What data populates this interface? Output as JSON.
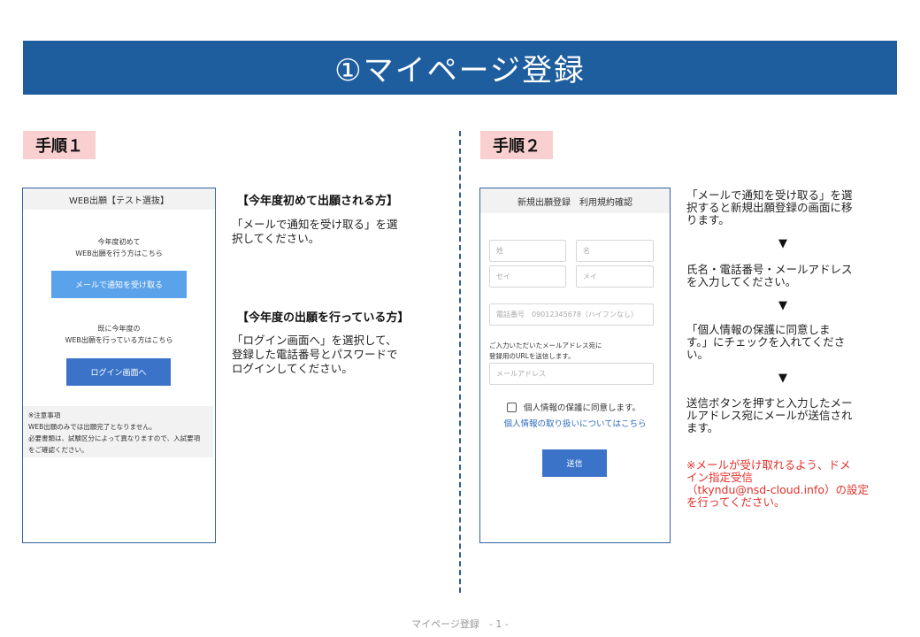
{
  "title": "①マイページ登録",
  "step1": {
    "badge": "手順１",
    "phone": {
      "header": "WEB出願【テスト選抜】",
      "first_time_line1": "今年度初めて",
      "first_time_line2": "WEB出願を行う方はこちら",
      "mail_button": "メールで通知を受け取る",
      "existing_line1": "既に今年度の",
      "existing_line2": "WEB出願を行っている方はこちら",
      "login_button": "ログイン画面へ",
      "notes": [
        "※注意事項",
        "WEB出願のみでは出願完了となりません。",
        "必要書類は、試験区分によって異なりますので、入試要項",
        "をご確認ください。"
      ]
    },
    "heading1": "【今年度初めて出願される方】",
    "text1": [
      "「メールで通知を受け取る」を選",
      "択してください。"
    ],
    "heading2": "【今年度の出願を行っている方】",
    "text2": [
      "「ログイン画面へ」を選択して、",
      "登録した電話番号とパスワードで",
      "ログインしてください。"
    ]
  },
  "step2": {
    "badge": "手順２",
    "phone": {
      "header": "新規出願登録　利用規約確認",
      "last_name": "姓",
      "first_name": "名",
      "last_kana": "セイ",
      "first_kana": "メイ",
      "phone_placeholder": "電話番号　09012345678（ハイフンなし）",
      "email_note_line1": "ご入力いただいたメールアドレス宛に",
      "email_note_line2": "登録用のURLを送信します。",
      "email_placeholder": "メールアドレス",
      "consent_label": "個人情報の保護に同意します。",
      "privacy_link": "個人情報の取り扱いについてはこちら",
      "send_button": "送信"
    },
    "instructions": [
      [
        "「メールで通知を受け取る」を選",
        "択すると新規出願登録の画面に移",
        "ります。"
      ],
      [
        "氏名・電話番号・メールアドレス",
        "を入力してください。"
      ],
      [
        "「個人情報の保護に同意しま",
        "す。」にチェックを入れてくださ",
        "い。"
      ],
      [
        "送信ボタンを押すと入力したメー",
        "ルアドレス宛にメールが送信され",
        "ます。"
      ]
    ],
    "arrow": "▼",
    "warning": [
      "※メールが受け取れるよう、ドメ",
      "イン指定受信",
      "（tkyndu@nsd-cloud.info）の設定",
      "を行ってください。"
    ]
  },
  "footer": "マイページ登録　- 1 -",
  "colors": {
    "title_bg": "#1f5e9e",
    "badge_bg": "#f9cfcf",
    "accent_blue": "#3a73c8",
    "warning_red": "#e0302a"
  }
}
